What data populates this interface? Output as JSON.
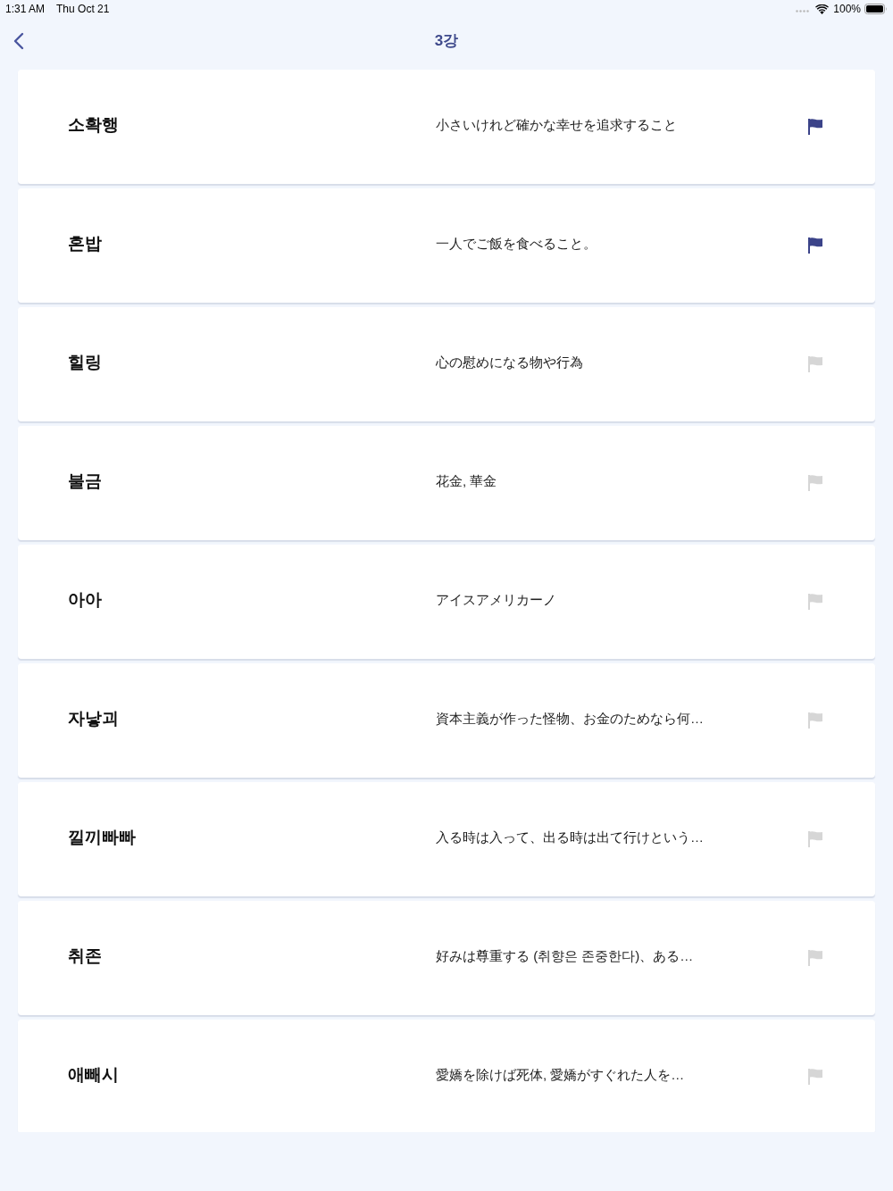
{
  "status_bar": {
    "time": "1:31 AM",
    "date": "Thu Oct 21",
    "battery": "100%"
  },
  "nav_bar": {
    "title": "3강"
  },
  "words": [
    {
      "word": "소확행",
      "meaning": "小さいけれど確かな幸せを追求すること",
      "flagged": true
    },
    {
      "word": "혼밥",
      "meaning": "一人でご飯を食べること。",
      "flagged": true
    },
    {
      "word": "힐링",
      "meaning": "心の慰めになる物や行為",
      "flagged": false
    },
    {
      "word": "불금",
      "meaning": "花金, 華金",
      "flagged": false
    },
    {
      "word": "아아",
      "meaning": "アイスアメリカーノ",
      "flagged": false
    },
    {
      "word": "자낳괴",
      "meaning": "資本主義が作った怪物、お金のためなら何…",
      "flagged": false
    },
    {
      "word": "낄끼빠빠",
      "meaning": "入る時は入って、出る時は出て行けという…",
      "flagged": false
    },
    {
      "word": "취존",
      "meaning": "好みは尊重する (취향은 존중한다)、ある…",
      "flagged": false
    },
    {
      "word": "애빼시",
      "meaning": "愛嬌を除けば死体, 愛嬌がすぐれた人を…",
      "flagged": false
    }
  ]
}
